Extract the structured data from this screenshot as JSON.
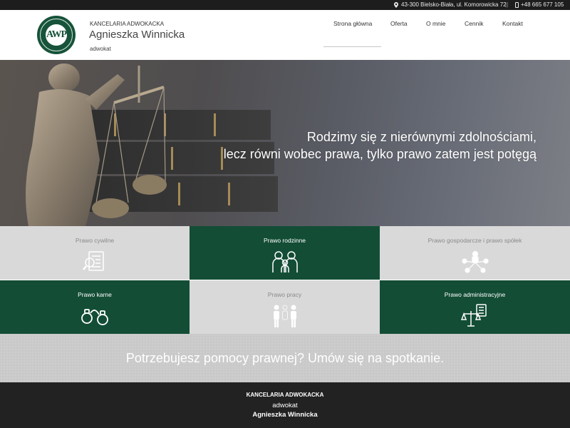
{
  "topbar": {
    "address": "43-300 Bielsko-Biała, ul. Komorowicka 72",
    "separator": "||",
    "phone": "+48 665 677 105"
  },
  "header": {
    "logo_text": "AWP",
    "office_label": "KANCELARIA ADWOKACKA",
    "name": "Agnieszka Winnicka",
    "role": "adwokat"
  },
  "nav": {
    "items": [
      {
        "label": "Strona główna",
        "active": true
      },
      {
        "label": "Oferta"
      },
      {
        "label": "O mnie"
      },
      {
        "label": "Cennik"
      },
      {
        "label": "Kontakt"
      }
    ]
  },
  "hero": {
    "line1": "Rodzimy się z nierównymi zdolnościami,",
    "line2": "lecz równi wobec prawa, tylko prawo zatem jest potęgą"
  },
  "tiles": [
    {
      "label": "Prawo cywilne",
      "icon": "document-magnifier-icon",
      "theme": "light"
    },
    {
      "label": "Prawo rodzinne",
      "icon": "family-icon",
      "theme": "dark"
    },
    {
      "label": "Prawo gospodarcze i prawo spółek",
      "icon": "business-network-icon",
      "theme": "light"
    },
    {
      "label": "Prawo karne",
      "icon": "handcuffs-icon",
      "theme": "dark"
    },
    {
      "label": "Prawo pracy",
      "icon": "workers-icon",
      "theme": "light"
    },
    {
      "label": "Prawo administracyjne",
      "icon": "scales-document-icon",
      "theme": "dark"
    }
  ],
  "cta": {
    "text": "Potrzebujesz pomocy prawnej? Umów się na spotkanie."
  },
  "footer": {
    "office_label": "KANCELARIA ADWOKACKA",
    "role": "adwokat",
    "name": "Agnieszka Winnicka"
  },
  "colors": {
    "brand_green": "#134d36",
    "tile_light": "#d9d9d9",
    "topbar_bg": "#1d1d1d",
    "footer_bg": "#222222"
  }
}
